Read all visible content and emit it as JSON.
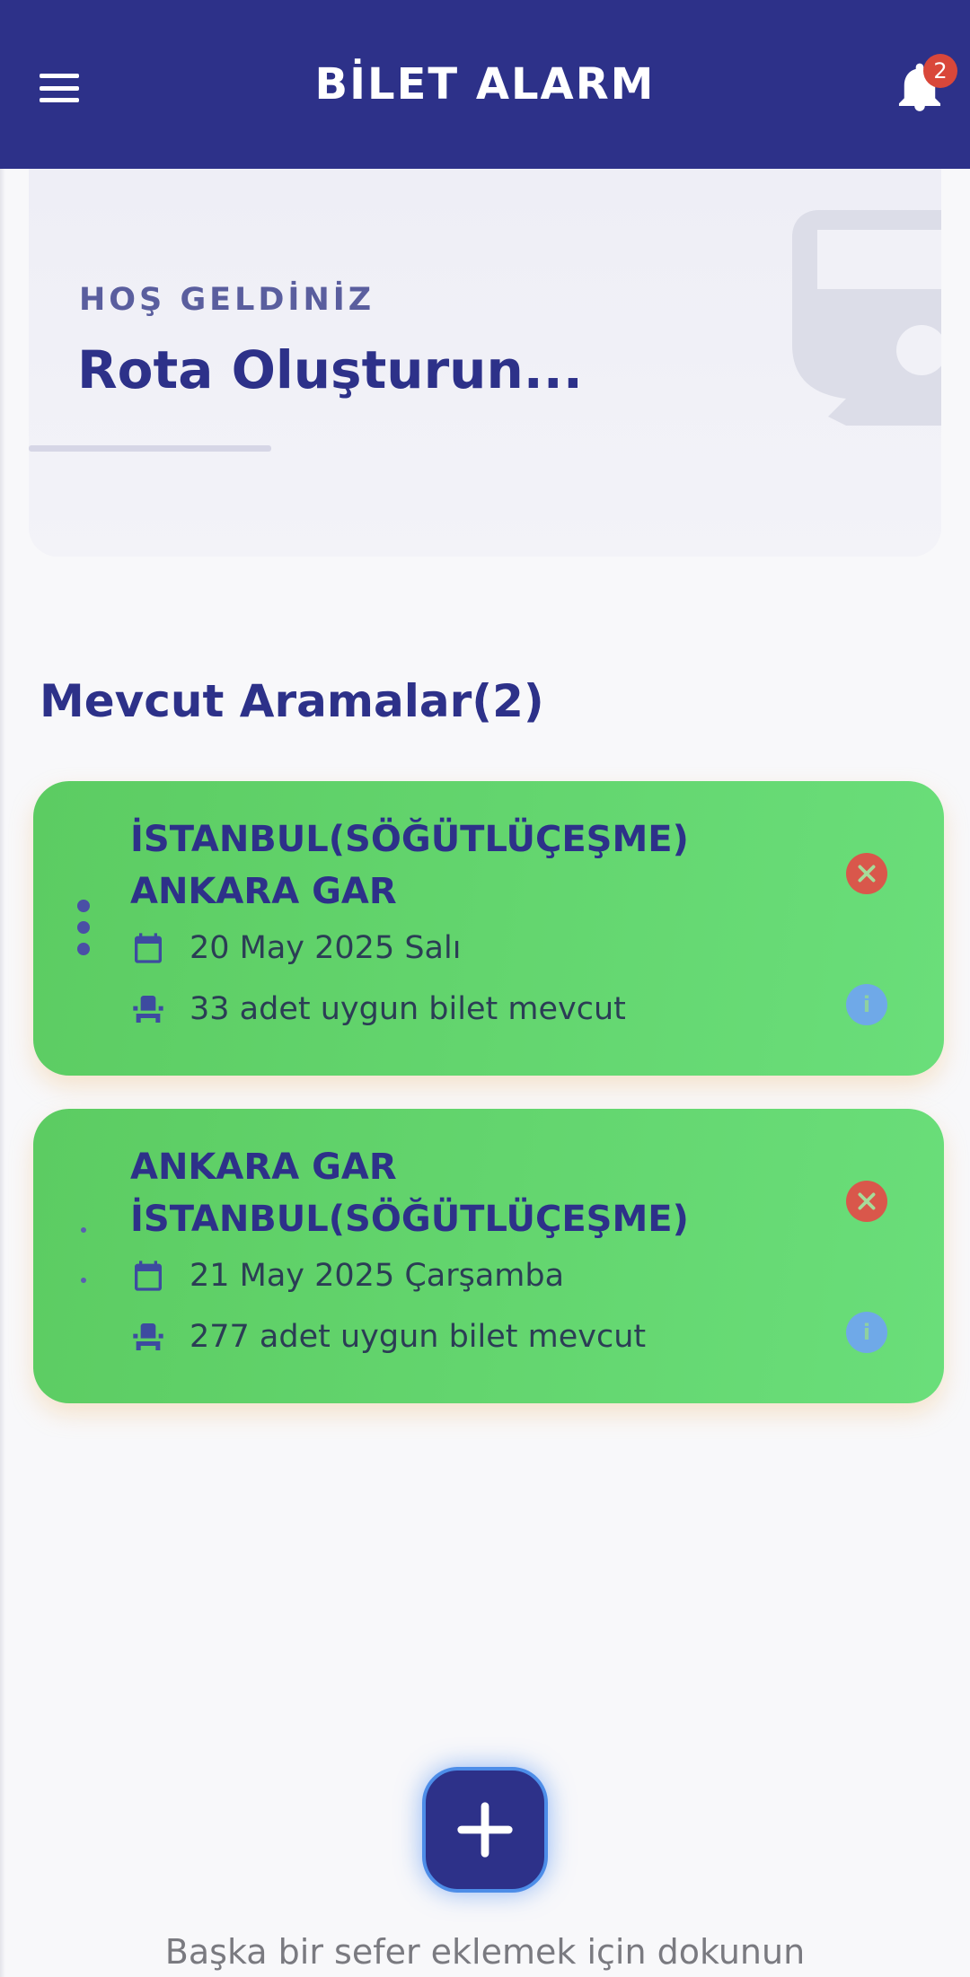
{
  "app": {
    "title": "BİLET ALARM",
    "notification_count": "2"
  },
  "welcome": {
    "kicker": "HOŞ GELDİNİZ",
    "title": "Rota Oluşturun..."
  },
  "section": {
    "title": "Mevcut Aramalar(2)"
  },
  "alarms": [
    {
      "from": "İSTANBUL(SÖĞÜTLÜÇEŞME)",
      "to": "ANKARA GAR",
      "date": "20 May 2025 Salı",
      "seats": "33 adet uygun bilet mevcut"
    },
    {
      "from": "ANKARA GAR",
      "to": "İSTANBUL(SÖĞÜTLÜÇEŞME)",
      "date": "21 May 2025 Çarşamba",
      "seats": "277 adet uygun bilet mevcut"
    }
  ],
  "add": {
    "hint": "Başka bir sefer eklemek için dokunun"
  },
  "icons": {
    "menu": "menu-icon",
    "notifications": "bell-icon",
    "decor": "train-icon",
    "drag": "drag-handle-icon",
    "date": "calendar-icon",
    "seats": "seat-icon",
    "remove": "close-icon",
    "details": "info-icon",
    "add": "plus-icon"
  },
  "colors": {
    "primary": "#2d3189",
    "card_green": "#5ccc62",
    "danger": "#d9574b",
    "info": "#6fa9e8",
    "badge": "#d9473a"
  }
}
